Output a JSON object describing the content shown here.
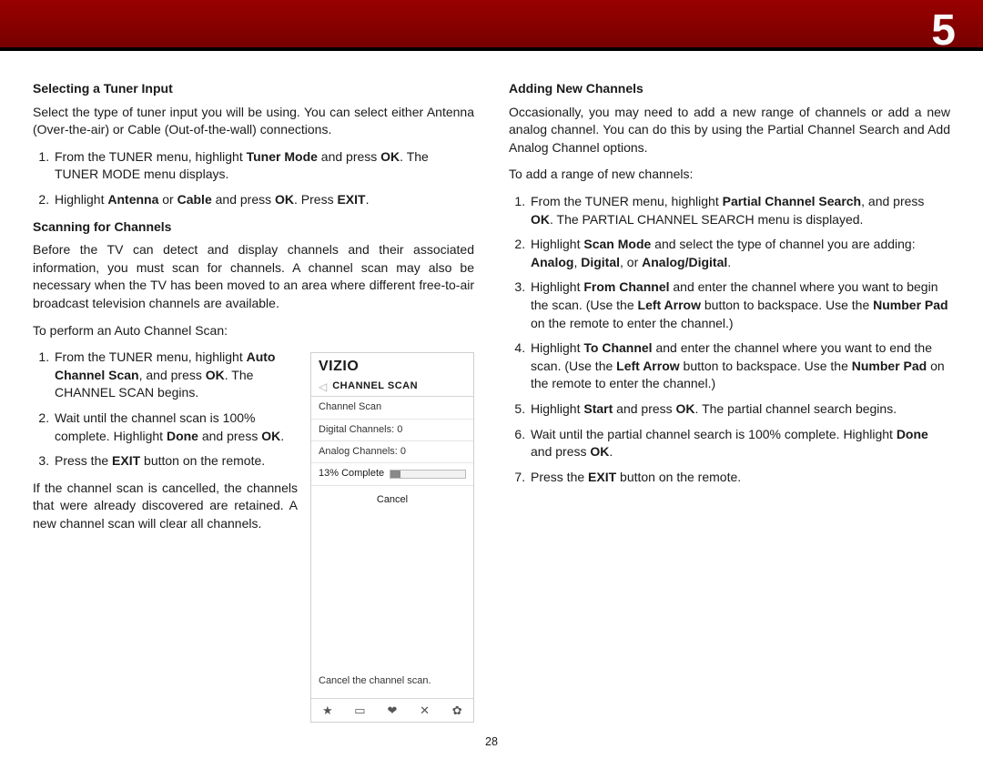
{
  "chapter_number": "5",
  "page_number": "28",
  "col1": {
    "sec1": {
      "h": "Selecting a Tuner Input",
      "p": "Select the type of tuner input you will be using. You can select either Antenna (Over-the-air) or Cable (Out-of-the-wall) connections.",
      "li1_a": "From the TUNER menu, highlight ",
      "li1_b1": "Tuner Mode",
      "li1_c": " and press ",
      "li1_b2": "OK",
      "li1_d": ". The TUNER MODE menu displays.",
      "li2_a": "Highlight ",
      "li2_b1": "Antenna",
      "li2_c": " or ",
      "li2_b2": "Cable",
      "li2_d": " and press ",
      "li2_b3": "OK",
      "li2_e": ". Press ",
      "li2_b4": "EXIT",
      "li2_f": "."
    },
    "sec2": {
      "h": "Scanning for Channels",
      "p1": "Before the TV can detect and display channels and their associated information, you must scan for channels. A channel scan may also be necessary when the TV has been moved to an area where different free-to-air broadcast television channels are available.",
      "p2": "To perform an Auto Channel Scan:",
      "li1_a": "From the TUNER menu, highlight ",
      "li1_b1": "Auto Channel Scan",
      "li1_c": ", and press ",
      "li1_b2": "OK",
      "li1_d": ". The CHANNEL SCAN begins.",
      "li2_a": "Wait until the channel scan is 100% complete. Highlight ",
      "li2_b1": "Done",
      "li2_c": " and press ",
      "li2_b2": "OK",
      "li2_d": ".",
      "li3_a": "Press the ",
      "li3_b1": "EXIT",
      "li3_c": " button on the remote.",
      "p3": "If the channel scan is cancelled, the channels that were already discovered are retained. A new channel scan will clear all channels."
    }
  },
  "fig": {
    "brand": "VIZIO",
    "title": "CHANNEL SCAN",
    "row1": "Channel Scan",
    "row2": "Digital Channels: 0",
    "row3": "Analog Channels: 0",
    "progress_label": "13% Complete",
    "progress_pct": 13,
    "cancel": "Cancel",
    "footer_text": "Cancel the channel scan.",
    "icons": {
      "star": "★",
      "tv": "▭",
      "v": "❤",
      "x": "✕",
      "gear": "✿"
    }
  },
  "col2": {
    "sec": {
      "h": "Adding New Channels",
      "p1": "Occasionally, you may need to add a new range of channels  or add a new analog channel. You can do this by using the Partial Channel Search and Add Analog Channel options.",
      "p2": "To add a range of new channels:",
      "li1_a": "From the TUNER menu, highlight ",
      "li1_b1": "Partial Channel Search",
      "li1_c": ", and press ",
      "li1_b2": "OK",
      "li1_d": ". The PARTIAL CHANNEL SEARCH menu is displayed.",
      "li2_a": "Highlight ",
      "li2_b1": "Scan Mode",
      "li2_c": " and select the type of channel you are adding: ",
      "li2_b2": "Analog",
      "li2_d": ", ",
      "li2_b3": "Digital",
      "li2_e": ", or ",
      "li2_b4": "Analog/Digital",
      "li2_f": ".",
      "li3_a": "Highlight ",
      "li3_b1": "From Channel",
      "li3_c": " and enter the channel where you want to begin the scan. (Use the ",
      "li3_b2": "Left Arrow",
      "li3_d": "  button to backspace. Use the ",
      "li3_b3": "Number Pad",
      "li3_e": " on the remote to enter the channel.)",
      "li4_a": "Highlight ",
      "li4_b1": "To Channel",
      "li4_c": " and enter the channel where you want to end the scan. (Use the ",
      "li4_b2": "Left Arrow",
      "li4_d": "  button to backspace. Use the ",
      "li4_b3": "Number Pad",
      "li4_e": " on the remote to enter the channel.)",
      "li5_a": "Highlight ",
      "li5_b1": "Start",
      "li5_c": " and press ",
      "li5_b2": "OK",
      "li5_d": ". The partial channel search begins.",
      "li6_a": "Wait until the partial channel search is 100% complete. Highlight ",
      "li6_b1": "Done",
      "li6_c": " and press ",
      "li6_b2": "OK",
      "li6_d": ".",
      "li7_a": "Press the ",
      "li7_b1": "EXIT",
      "li7_c": " button on the remote."
    }
  }
}
